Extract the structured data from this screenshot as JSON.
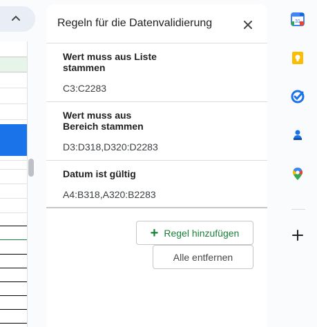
{
  "panel": {
    "title": "Regeln für die Datenvalidierung",
    "close_icon": "close-icon"
  },
  "rules": [
    {
      "title": "Wert muss aus Liste\nstammen",
      "range": "C3:C2283"
    },
    {
      "title": "Wert muss aus\nBereich stammen",
      "range": "D3:D318,D320:D2283"
    },
    {
      "title": "Datum ist gültig",
      "range": "A4:B318,A320:B2283"
    }
  ],
  "actions": {
    "add_label": "Regel hinzufügen",
    "add_icon": "plus-icon",
    "remove_label": "Alle entfernen"
  },
  "side_rail": {
    "icons": [
      "calendar-icon",
      "keep-icon",
      "tasks-icon",
      "contacts-icon",
      "maps-icon",
      "add-addon-icon"
    ],
    "calendar_day": "31"
  },
  "colors": {
    "accent_green": "#188038",
    "selection_blue": "#1a73e8",
    "panel_bg": "#ffffff",
    "page_bg": "#f9fbfd"
  }
}
